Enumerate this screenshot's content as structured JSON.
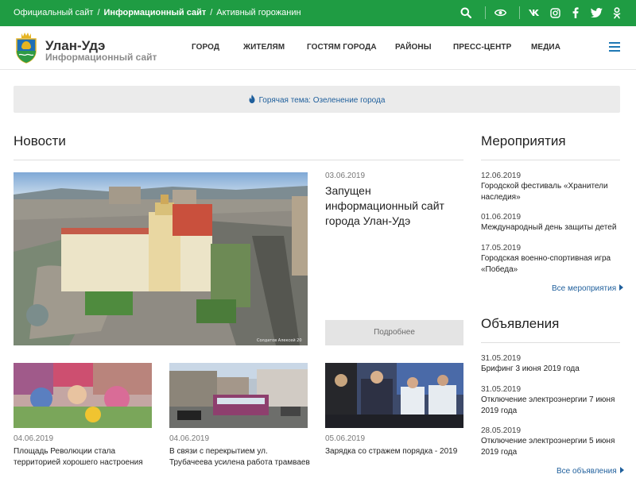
{
  "topbar": {
    "links": [
      {
        "label": "Официальный сайт"
      },
      {
        "label": "Информационный сайт"
      },
      {
        "label": "Активный горожанин"
      }
    ],
    "separator": "/",
    "icons": [
      "search-icon",
      "eye-icon",
      "vk-icon",
      "instagram-icon",
      "facebook-icon",
      "twitter-icon",
      "odnoklassniki-icon"
    ],
    "color": "#1f9c43"
  },
  "header": {
    "title": "Улан-Удэ",
    "subtitle": "Информационный сайт",
    "nav": [
      "ГОРОД",
      "ЖИТЕЛЯМ",
      "ГОСТЯМ ГОРОДА",
      "РАЙОНЫ",
      "ПРЕСС-ЦЕНТР",
      "МЕДИА"
    ]
  },
  "hot": {
    "label": "Горячая тема: Озеленение города"
  },
  "news": {
    "heading": "Новости",
    "main": {
      "date": "03.06.2019",
      "title": "Запущен информационный сайт города Улан-Удэ",
      "more": "Подробнее",
      "photo_credit": "Солдатов Алексей 20"
    },
    "cards": [
      {
        "date": "04.06.2019",
        "title": "Площадь Революции стала территорией хорошего настроения"
      },
      {
        "date": "04.06.2019",
        "title": "В связи с перекрытием ул. Трубачеева усилена работа трамваев"
      },
      {
        "date": "05.06.2019",
        "title": "Зарядка со стражем порядка - 2019"
      }
    ]
  },
  "events": {
    "heading": "Мероприятия",
    "items": [
      {
        "date": "12.06.2019",
        "title": "Городской фестиваль «Хранители наследия»"
      },
      {
        "date": "01.06.2019",
        "title": "Международный день защиты детей"
      },
      {
        "date": "17.05.2019",
        "title": "Городская военно-спортивная игра «Победа»"
      }
    ],
    "all": "Все мероприятия"
  },
  "ads": {
    "heading": "Объявления",
    "items": [
      {
        "date": "31.05.2019",
        "title": "Брифинг 3 июня 2019 года"
      },
      {
        "date": "31.05.2019",
        "title": "Отключение электроэнергии 7 июня 2019 года"
      },
      {
        "date": "28.05.2019",
        "title": "Отключение электроэнергии 5 июня 2019 года"
      }
    ],
    "all": "Все объявления"
  },
  "colors": {
    "accent": "#1f9c43",
    "link": "#1f5f9c",
    "menu": "#1f78b4"
  }
}
